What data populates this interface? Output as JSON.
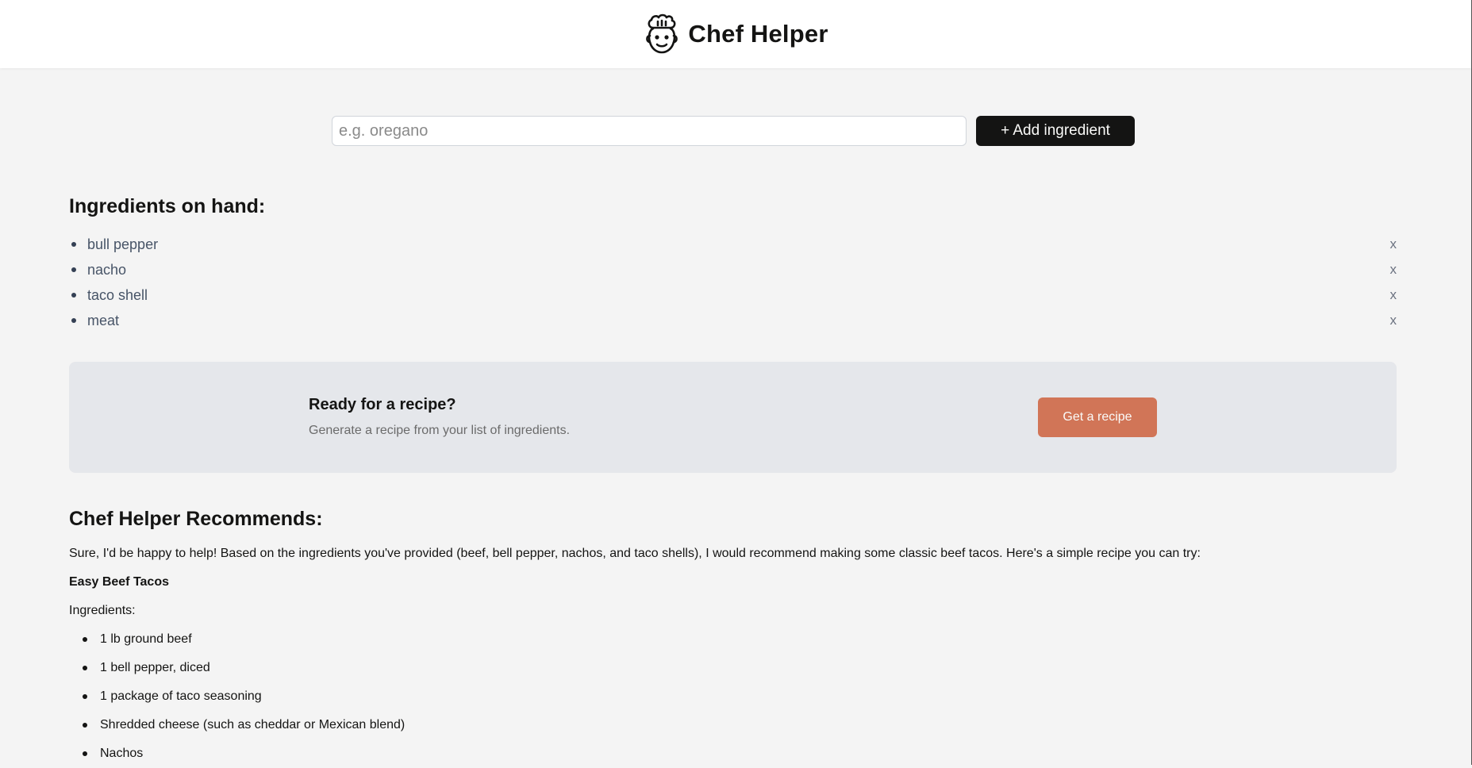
{
  "header": {
    "title": "Chef Helper",
    "logo_icon": "chef-face-icon"
  },
  "add_form": {
    "placeholder": "e.g. oregano",
    "value": "",
    "button_label": "+ Add ingredient"
  },
  "ingredients": {
    "title": "Ingredients on hand:",
    "remove_label": "x",
    "items": [
      {
        "name": "bull pepper"
      },
      {
        "name": "nacho"
      },
      {
        "name": "taco shell"
      },
      {
        "name": "meat"
      }
    ]
  },
  "cta": {
    "title": "Ready for a recipe?",
    "subtitle": "Generate a recipe from your list of ingredients.",
    "button_label": "Get a recipe",
    "button_color": "#d17557",
    "background_color": "#e5e7eb"
  },
  "recommendation": {
    "title": "Chef Helper Recommends:",
    "intro": "Sure, I'd be happy to help! Based on the ingredients you've provided (beef, bell pepper, nachos, and taco shells), I would recommend making some classic beef tacos. Here's a simple recipe you can try:",
    "recipe_name": "Easy Beef Tacos",
    "ingredients_heading": "Ingredients:",
    "recipe_ingredients": [
      "1 lb ground beef",
      "1 bell pepper, diced",
      "1 package of taco seasoning",
      "Shredded cheese (such as cheddar or Mexican blend)",
      "Nachos"
    ]
  }
}
